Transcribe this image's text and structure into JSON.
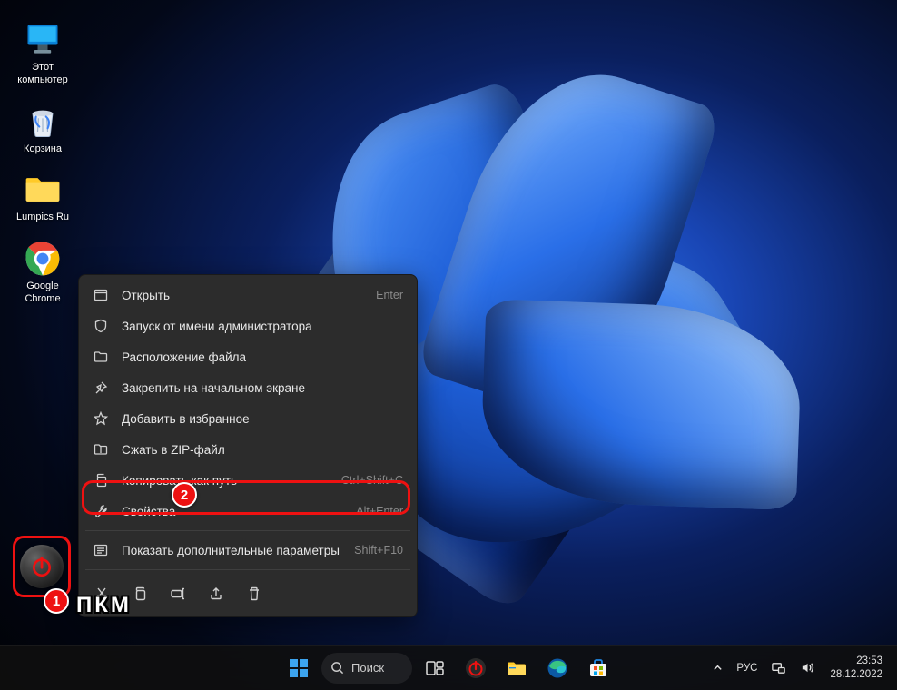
{
  "desktop_icons": [
    {
      "name": "this-pc",
      "label": "Этот\nкомпьютер"
    },
    {
      "name": "recycle-bin",
      "label": "Корзина"
    },
    {
      "name": "folder-lumpics",
      "label": "Lumpics Ru"
    },
    {
      "name": "chrome",
      "label": "Google\nChrome"
    }
  ],
  "context_menu": {
    "items": [
      {
        "name": "open",
        "icon": "window",
        "label": "Открыть",
        "shortcut": "Enter"
      },
      {
        "name": "run-admin",
        "icon": "shield",
        "label": "Запуск от имени администратора",
        "shortcut": ""
      },
      {
        "name": "file-location",
        "icon": "folder",
        "label": "Расположение файла",
        "shortcut": ""
      },
      {
        "name": "pin-start",
        "icon": "pin",
        "label": "Закрепить на начальном экране",
        "shortcut": ""
      },
      {
        "name": "add-fav",
        "icon": "star",
        "label": "Добавить в избранное",
        "shortcut": ""
      },
      {
        "name": "zip",
        "icon": "zip",
        "label": "Сжать в ZIP-файл",
        "shortcut": ""
      },
      {
        "name": "copy-path",
        "icon": "copy",
        "label": "Копировать как путь",
        "shortcut": "Ctrl+Shift+C"
      },
      {
        "name": "properties",
        "icon": "wrench",
        "label": "Свойства",
        "shortcut": "Alt+Enter"
      },
      {
        "name": "more-opts",
        "icon": "more",
        "label": "Показать дополнительные параметры",
        "shortcut": "Shift+F10"
      }
    ],
    "bar": [
      "cut",
      "copy",
      "rename",
      "share",
      "delete"
    ]
  },
  "annotations": {
    "badge1": "1",
    "badge2": "2",
    "pkm_label": "ПКМ"
  },
  "taskbar": {
    "search_label": "Поиск",
    "lang": "РУС",
    "time": "23:53",
    "date": "28.12.2022"
  }
}
